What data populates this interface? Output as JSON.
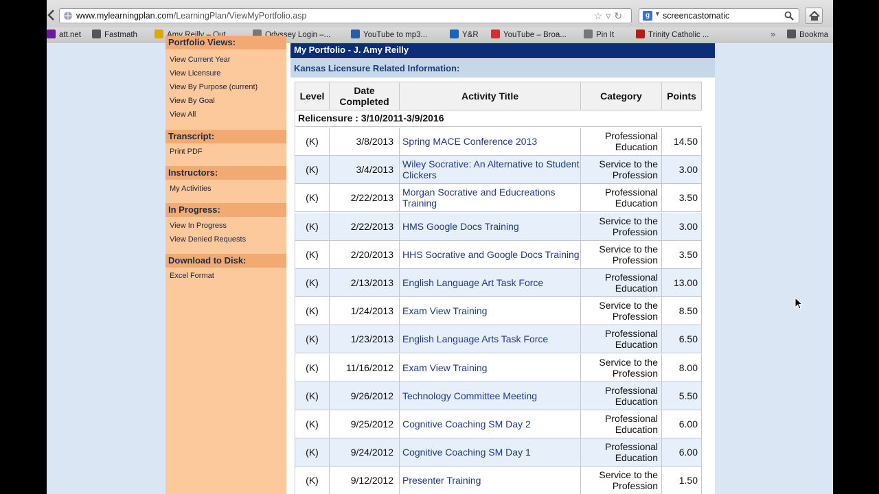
{
  "browser": {
    "url_domain": "www.mylearningplan.com",
    "url_path": "/LearningPlan/ViewMyPortfolio.asp",
    "search_text": "screencastomatic",
    "bookmarks": [
      {
        "label": "att.net",
        "icon": "yahoo-icon",
        "color": "#6a1b9a"
      },
      {
        "label": "Fastmath",
        "icon": "fastmath-icon",
        "color": "#555555"
      },
      {
        "label": "Amy Reilly – Out...",
        "icon": "outlook-icon",
        "color": "#e0a800"
      },
      {
        "label": "Odyssey Login –...",
        "icon": "page-icon",
        "color": "#777777"
      },
      {
        "label": "YouTube to mp3...",
        "icon": "mp3-icon",
        "color": "#2a5caa"
      },
      {
        "label": "Y&R",
        "icon": "yr-icon",
        "color": "#1565c0"
      },
      {
        "label": "YouTube – Broa...",
        "icon": "youtube-icon",
        "color": "#d32f2f"
      },
      {
        "label": "Pin It",
        "icon": "page-icon",
        "color": "#777777"
      },
      {
        "label": "Trinity Catholic ...",
        "icon": "trinity-icon",
        "color": "#b71c1c"
      },
      {
        "label": "Bookma",
        "icon": "bookmarks-icon",
        "color": "#555555"
      }
    ]
  },
  "sidebar": {
    "top_label": "Portfolio Views:",
    "views": [
      "View Current Year",
      "View Licensure",
      "View By Purpose (current)",
      "View By Goal",
      "View All"
    ],
    "sections": [
      {
        "heading": "Transcript:",
        "links": [
          "Print PDF"
        ]
      },
      {
        "heading": "Instructors:",
        "links": [
          "My Activities"
        ]
      },
      {
        "heading": "In Progress:",
        "links": [
          "View In Progress",
          "View Denied Requests"
        ]
      },
      {
        "heading": "Download to Disk:",
        "links": [
          "Excel Format"
        ]
      }
    ]
  },
  "main": {
    "portfolio_title": "My Portfolio - J. Amy Reilly",
    "section_title": "Kansas Licensure Related Information:",
    "table": {
      "headers": [
        "Level",
        "Date Completed",
        "Activity Title",
        "Category",
        "Points"
      ],
      "group_label": "Relicensure : 3/10/2011-3/9/2016",
      "rows": [
        {
          "level": "(K)",
          "date": "3/8/2013",
          "title": "Spring MACE Conference 2013",
          "category": "Professional Education",
          "points": "14.50"
        },
        {
          "level": "(K)",
          "date": "3/4/2013",
          "title": "Wiley Socrative: An Alternative to Student Clickers",
          "category": "Service to the Profession",
          "points": "3.00"
        },
        {
          "level": "(K)",
          "date": "2/22/2013",
          "title": "Morgan Socrative and Educreations Training",
          "category": "Professional Education",
          "points": "3.50"
        },
        {
          "level": "(K)",
          "date": "2/22/2013",
          "title": "HMS Google Docs Training",
          "category": "Service to the Profession",
          "points": "3.00"
        },
        {
          "level": "(K)",
          "date": "2/20/2013",
          "title": "HHS Socrative and Google Docs Training",
          "category": "Service to the Profession",
          "points": "3.50"
        },
        {
          "level": "(K)",
          "date": "2/13/2013",
          "title": "English Language Art Task Force",
          "category": "Professional Education",
          "points": "13.00"
        },
        {
          "level": "(K)",
          "date": "1/24/2013",
          "title": "Exam View Training",
          "category": "Service to the Profession",
          "points": "8.50"
        },
        {
          "level": "(K)",
          "date": "1/23/2013",
          "title": "English Language Arts Task Force",
          "category": "Professional Education",
          "points": "6.50"
        },
        {
          "level": "(K)",
          "date": "11/16/2012",
          "title": "Exam View Training",
          "category": "Service to the Profession",
          "points": "8.00"
        },
        {
          "level": "(K)",
          "date": "9/26/2012",
          "title": "Technology Committee Meeting",
          "category": "Professional Education",
          "points": "5.50"
        },
        {
          "level": "(K)",
          "date": "9/25/2012",
          "title": "Cognitive Coaching SM Day 2",
          "category": "Professional Education",
          "points": "6.00"
        },
        {
          "level": "(K)",
          "date": "9/24/2012",
          "title": "Cognitive Coaching SM Day 1",
          "category": "Professional Education",
          "points": "6.00"
        },
        {
          "level": "(K)",
          "date": "9/12/2012",
          "title": "Presenter Training",
          "category": "Service to the Profession",
          "points": "1.50"
        }
      ]
    }
  }
}
